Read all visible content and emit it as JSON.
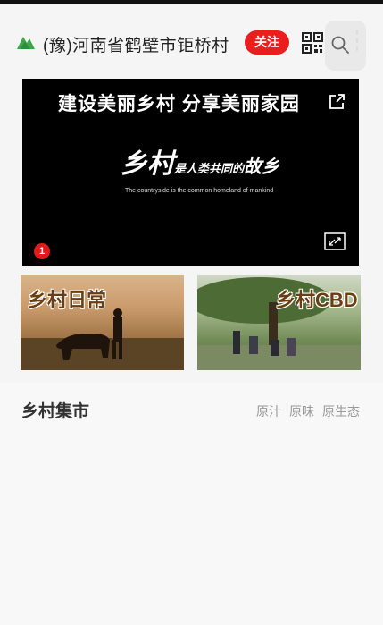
{
  "header": {
    "title": "(豫)河南省鹤壁市钜桥村",
    "follow_label": "关注",
    "logo_icon": "mountain-logo-icon",
    "qr_icon": "qr-code-icon",
    "search_icon": "search-icon",
    "brand_color": "#3aa64a",
    "accent_color": "#ea1e1e"
  },
  "banner": {
    "headline": "建设美丽乡村 分享美丽家园",
    "calligraphy_big": "乡村",
    "calligraphy_rest": "是人类共同的",
    "calligraphy_end": "故乡",
    "english": "The countryside is the common homeland of mankind",
    "page_indicator": "1",
    "share_icon": "share-icon",
    "expand_icon": "expand-icon"
  },
  "tiles": [
    {
      "label": "乡村日常"
    },
    {
      "label": "乡村CBD"
    }
  ],
  "market": {
    "title": "乡村集市",
    "tags": [
      "原汁",
      "原味",
      "原生态"
    ]
  }
}
